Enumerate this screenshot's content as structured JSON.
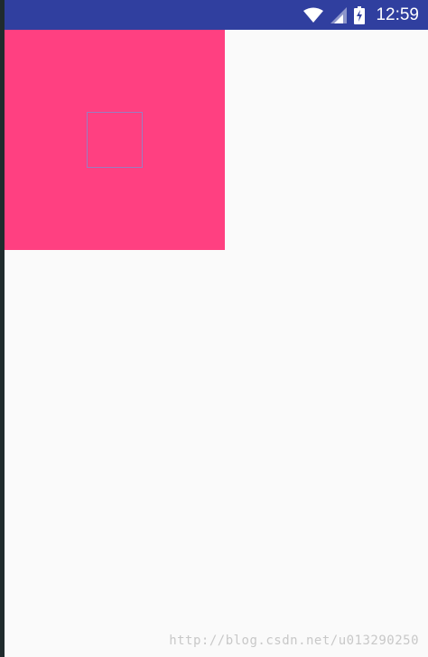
{
  "status_bar": {
    "time": "12:59",
    "background_color": "#303f9f",
    "icons": [
      "wifi-icon",
      "cell-signal-icon",
      "battery-charging-icon"
    ]
  },
  "content": {
    "square_color": "#ff4081",
    "inner_box_border_color": "#9b7cc0",
    "background_color": "#fafafa"
  },
  "watermark": {
    "text": "http://blog.csdn.net/u013290250"
  }
}
